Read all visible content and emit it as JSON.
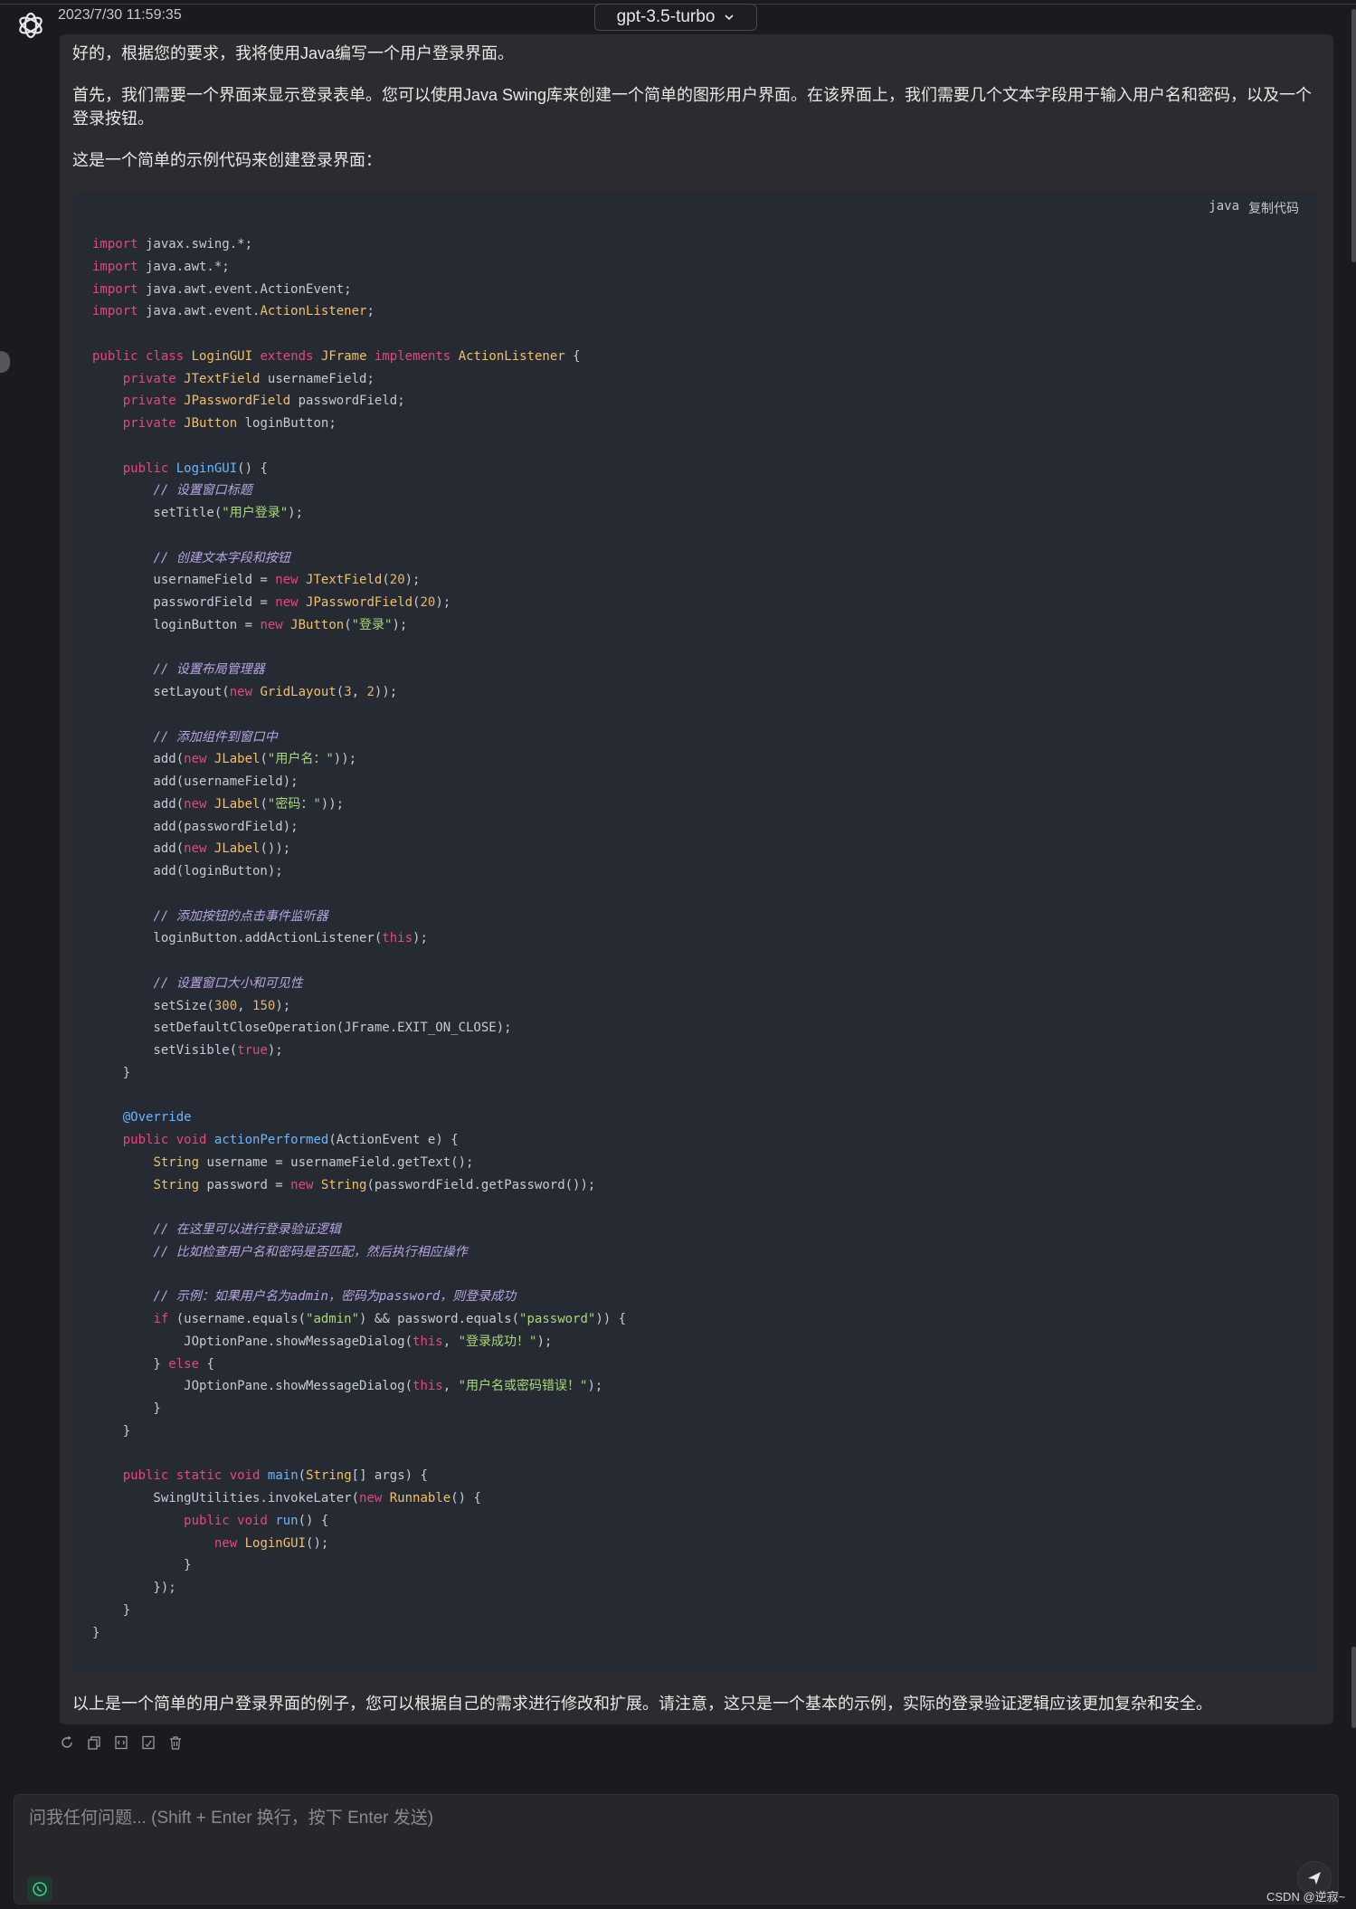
{
  "header": {
    "timestamp": "2023/7/30 11:59:35",
    "model": "gpt-3.5-turbo"
  },
  "message": {
    "intro": "好的，根据您的要求，我将使用Java编写一个用户登录界面。",
    "para1": "首先，我们需要一个界面来显示登录表单。您可以使用Java Swing库来创建一个简单的图形用户界面。在该界面上，我们需要几个文本字段用于输入用户名和密码，以及一个登录按钮。",
    "para2": "这是一个简单的示例代码来创建登录界面：",
    "code_language": "java",
    "copy_label": "复制代码",
    "code_lines": [
      "import javax.swing.*;",
      "import java.awt.*;",
      "import java.awt.event.ActionEvent;",
      "import java.awt.event.ActionListener;",
      "",
      "public class LoginGUI extends JFrame implements ActionListener {",
      "    private JTextField usernameField;",
      "    private JPasswordField passwordField;",
      "    private JButton loginButton;",
      "",
      "    public LoginGUI() {",
      "        // 设置窗口标题",
      "        setTitle(\"用户登录\");",
      "",
      "        // 创建文本字段和按钮",
      "        usernameField = new JTextField(20);",
      "        passwordField = new JPasswordField(20);",
      "        loginButton = new JButton(\"登录\");",
      "",
      "        // 设置布局管理器",
      "        setLayout(new GridLayout(3, 2));",
      "",
      "        // 添加组件到窗口中",
      "        add(new JLabel(\"用户名：\"));",
      "        add(usernameField);",
      "        add(new JLabel(\"密码：\"));",
      "        add(passwordField);",
      "        add(new JLabel());",
      "        add(loginButton);",
      "",
      "        // 添加按钮的点击事件监听器",
      "        loginButton.addActionListener(this);",
      "",
      "        // 设置窗口大小和可见性",
      "        setSize(300, 150);",
      "        setDefaultCloseOperation(JFrame.EXIT_ON_CLOSE);",
      "        setVisible(true);",
      "    }",
      "",
      "    @Override",
      "    public void actionPerformed(ActionEvent e) {",
      "        String username = usernameField.getText();",
      "        String password = new String(passwordField.getPassword());",
      "",
      "        // 在这里可以进行登录验证逻辑",
      "        // 比如检查用户名和密码是否匹配，然后执行相应操作",
      "",
      "        // 示例：如果用户名为admin，密码为password，则登录成功",
      "        if (username.equals(\"admin\") && password.equals(\"password\")) {",
      "            JOptionPane.showMessageDialog(this, \"登录成功！\");",
      "        } else {",
      "            JOptionPane.showMessageDialog(this, \"用户名或密码错误！\");",
      "        }",
      "    }",
      "",
      "    public static void main(String[] args) {",
      "        SwingUtilities.invokeLater(new Runnable() {",
      "            public void run() {",
      "                new LoginGUI();",
      "            }",
      "        });",
      "    }",
      "}"
    ],
    "outro": "以上是一个简单的用户登录界面的例子，您可以根据自己的需求进行修改和扩展。请注意，这只是一个基本的示例，实际的登录验证逻辑应该更加复杂和安全。"
  },
  "actions": {
    "icons": [
      "regenerate-icon",
      "copy-icon",
      "code-icon",
      "export-icon",
      "delete-icon"
    ]
  },
  "composer": {
    "placeholder": "问我任何问题... (Shift + Enter 换行，按下 Enter 发送)"
  },
  "watermark": "CSDN @逆寂~",
  "colors": {
    "background": "#1b1b1f",
    "bubble": "#2b2b30",
    "code_bg": "#262a33",
    "keyword": "#e5487b",
    "type": "#f0c06a",
    "function": "#69b7ff",
    "string": "#a8d878",
    "number": "#e5b76a",
    "comment": "#b7a5e0"
  }
}
